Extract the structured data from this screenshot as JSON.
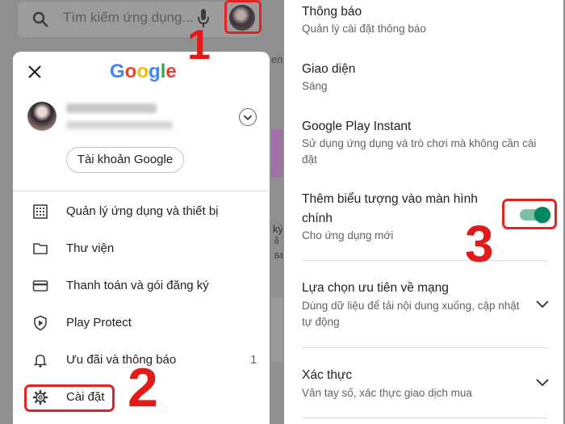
{
  "left": {
    "search": {
      "placeholder": "Tìm kiếm ứng dụng..."
    },
    "background": {
      "tab_text": "em",
      "text_1": "ký",
      "text_2": "ỗ",
      "text_3": "84"
    },
    "menu": {
      "google_logo": [
        "G",
        "o",
        "o",
        "g",
        "l",
        "e"
      ],
      "google_logo_colors": [
        "#4285F4",
        "#EA4335",
        "#FBBC05",
        "#4285F4",
        "#34A853",
        "#EA4335"
      ],
      "google_account_button": "Tài khoản Google",
      "items": [
        {
          "label": "Quản lý ứng dụng và thiết bị",
          "icon": "grid-icon"
        },
        {
          "label": "Thư viện",
          "icon": "folder-icon"
        },
        {
          "label": "Thanh toán và gói đăng ký",
          "icon": "credit-card-icon"
        },
        {
          "label": "Play Protect",
          "icon": "shield-play-icon"
        },
        {
          "label": "Ưu đãi và thông báo",
          "icon": "bell-icon",
          "count": "1"
        },
        {
          "label": "Cài đặt",
          "icon": "gear-icon"
        }
      ]
    },
    "steps": {
      "step1": "1",
      "step2": "2"
    }
  },
  "right": {
    "settings": [
      {
        "title": "Thông báo",
        "subtitle": "Quản lý cài đặt thông báo"
      },
      {
        "title": "Giao diện",
        "subtitle": "Sáng"
      },
      {
        "title": "Google Play Instant",
        "subtitle_line1": "Sử dụng ứng dụng và trò chơi mà không cần cài",
        "subtitle_line2": "đặt"
      },
      {
        "title_line1": "Thêm biểu tượng vào màn hình",
        "title_line2": "chính",
        "subtitle": "Cho ứng dụng mới",
        "toggle_on": true
      },
      {
        "title": "Lựa chọn ưu tiên về mạng",
        "subtitle_line1": "Dùng dữ liệu để tải nội dung xuống, cập nhật",
        "subtitle_line2": "tự động"
      },
      {
        "title": "Xác thực",
        "subtitle": "Vân tay số, xác thực giao dịch mua"
      }
    ],
    "step3": "3"
  },
  "colors": {
    "accent_green": "#01875f",
    "highlight_red": "#e32222"
  }
}
